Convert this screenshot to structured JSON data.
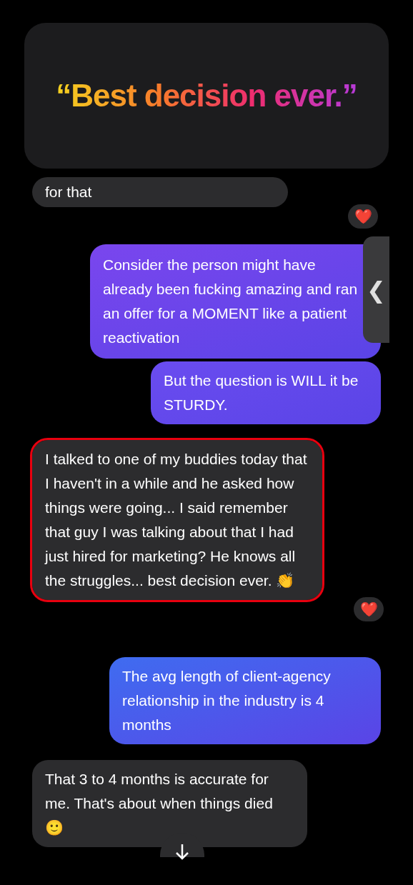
{
  "banner": {
    "quote": "“Best decision ever.”"
  },
  "messages": [
    {
      "kind": "incoming",
      "text": "for that",
      "reaction": "❤️",
      "highlighted": false
    },
    {
      "kind": "outgoing",
      "color": "#7a46ee",
      "text": "Consider the person might have already been fucking amazing and ran an offer for a MOMENT like a patient reactivation",
      "highlighted": false
    },
    {
      "kind": "outgoing",
      "color": "#6a4cf0",
      "text": "But the question is WILL it be STURDY.",
      "highlighted": false
    },
    {
      "kind": "incoming",
      "text": "I talked to one of my buddies today that I haven't in a while and he asked how things were going... I said remember that guy I was talking about that I had just hired for marketing? He knows all the struggles... best decision ever. 👏",
      "reaction": "❤️",
      "highlighted": true
    },
    {
      "kind": "outgoing",
      "color": "#3f6cf0",
      "text": "The avg length of client-agency relationship in the industry is 4 months",
      "highlighted": false
    },
    {
      "kind": "incoming",
      "text": "That 3 to 4 months is accurate for me.  That's about when things died 🙂",
      "highlighted": false
    }
  ],
  "side_handle": {
    "glyph": "❮"
  }
}
